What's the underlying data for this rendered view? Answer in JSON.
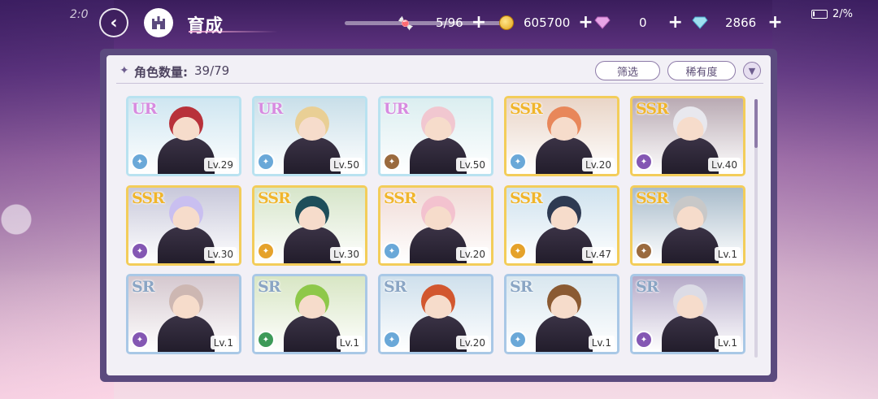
{
  "status": {
    "time": "2:0",
    "battery": "2/%"
  },
  "header": {
    "title": "育成",
    "back_icon": "back-arrow-icon",
    "home_icon": "castle-home-icon"
  },
  "resources": [
    {
      "icon": "candy-icon",
      "value": "5/96",
      "plus": "+"
    },
    {
      "icon": "gold-coin-icon",
      "value": "605700",
      "plus": "+"
    },
    {
      "icon": "pink-diamond-icon",
      "value": "0",
      "plus": "+"
    },
    {
      "icon": "blue-diamond-icon",
      "value": "2866",
      "plus": "+"
    }
  ],
  "panel": {
    "count_label": "角色数量:",
    "count_value": "39/79",
    "filter_label": "筛选",
    "rarity_label": "稀有度",
    "sort_icon": "sort-toggle-icon"
  },
  "colors": {
    "accent": "#8d7aa8",
    "panel_bg": "#f2f0f6",
    "ur_border": "#b9e2f0",
    "ssr_border": "#f3cd5a",
    "sr_border": "#a9c8e6"
  },
  "cards": [
    {
      "rarity": "UR",
      "level": "Lv.29",
      "class_color": "#6aa8d8",
      "hair": "#b8313a",
      "bg": "#cfe6f1"
    },
    {
      "rarity": "UR",
      "level": "Lv.50",
      "class_color": "#6aa8d8",
      "hair": "#e9cf95",
      "bg": "#c9dfe9"
    },
    {
      "rarity": "UR",
      "level": "Lv.50",
      "class_color": "#9a6a3e",
      "hair": "#f1c7d0",
      "bg": "#dbeef0"
    },
    {
      "rarity": "SSR",
      "level": "Lv.20",
      "class_color": "#6aa8d8",
      "hair": "#e8875a",
      "bg": "#e9d5c7"
    },
    {
      "rarity": "SSR",
      "level": "Lv.40",
      "class_color": "#8457b3",
      "hair": "#e8e8ee",
      "bg": "#b9aab3"
    },
    {
      "rarity": "SSR",
      "level": "Lv.30",
      "class_color": "#8457b3",
      "hair": "#c9bff0",
      "bg": "#c8c8da"
    },
    {
      "rarity": "SSR",
      "level": "Lv.30",
      "class_color": "#e5a22a",
      "hair": "#1e4e5a",
      "bg": "#d6e5c9"
    },
    {
      "rarity": "SSR",
      "level": "Lv.20",
      "class_color": "#6aa8d8",
      "hair": "#f3c2cf",
      "bg": "#f0dbd6"
    },
    {
      "rarity": "SSR",
      "level": "Lv.47",
      "class_color": "#e5a22a",
      "hair": "#2e3a52",
      "bg": "#cfe2ee"
    },
    {
      "rarity": "SSR",
      "level": "Lv.1",
      "class_color": "#9a6a3e",
      "hair": "#c8c8c8",
      "bg": "#a9bccb"
    },
    {
      "rarity": "SR",
      "level": "Lv.1",
      "class_color": "#8457b3",
      "hair": "#cdb7b2",
      "bg": "#d5c8cf"
    },
    {
      "rarity": "SR",
      "level": "Lv.1",
      "class_color": "#3d9a58",
      "hair": "#8ec84a",
      "bg": "#d8e6c4"
    },
    {
      "rarity": "SR",
      "level": "Lv.20",
      "class_color": "#6aa8d8",
      "hair": "#d2572f",
      "bg": "#cfe0ec"
    },
    {
      "rarity": "SR",
      "level": "Lv.1",
      "class_color": "#6aa8d8",
      "hair": "#8b5a32",
      "bg": "#d9e7ef"
    },
    {
      "rarity": "SR",
      "level": "Lv.1",
      "class_color": "#8457b3",
      "hair": "#dcdce6",
      "bg": "#b5aac8"
    }
  ]
}
